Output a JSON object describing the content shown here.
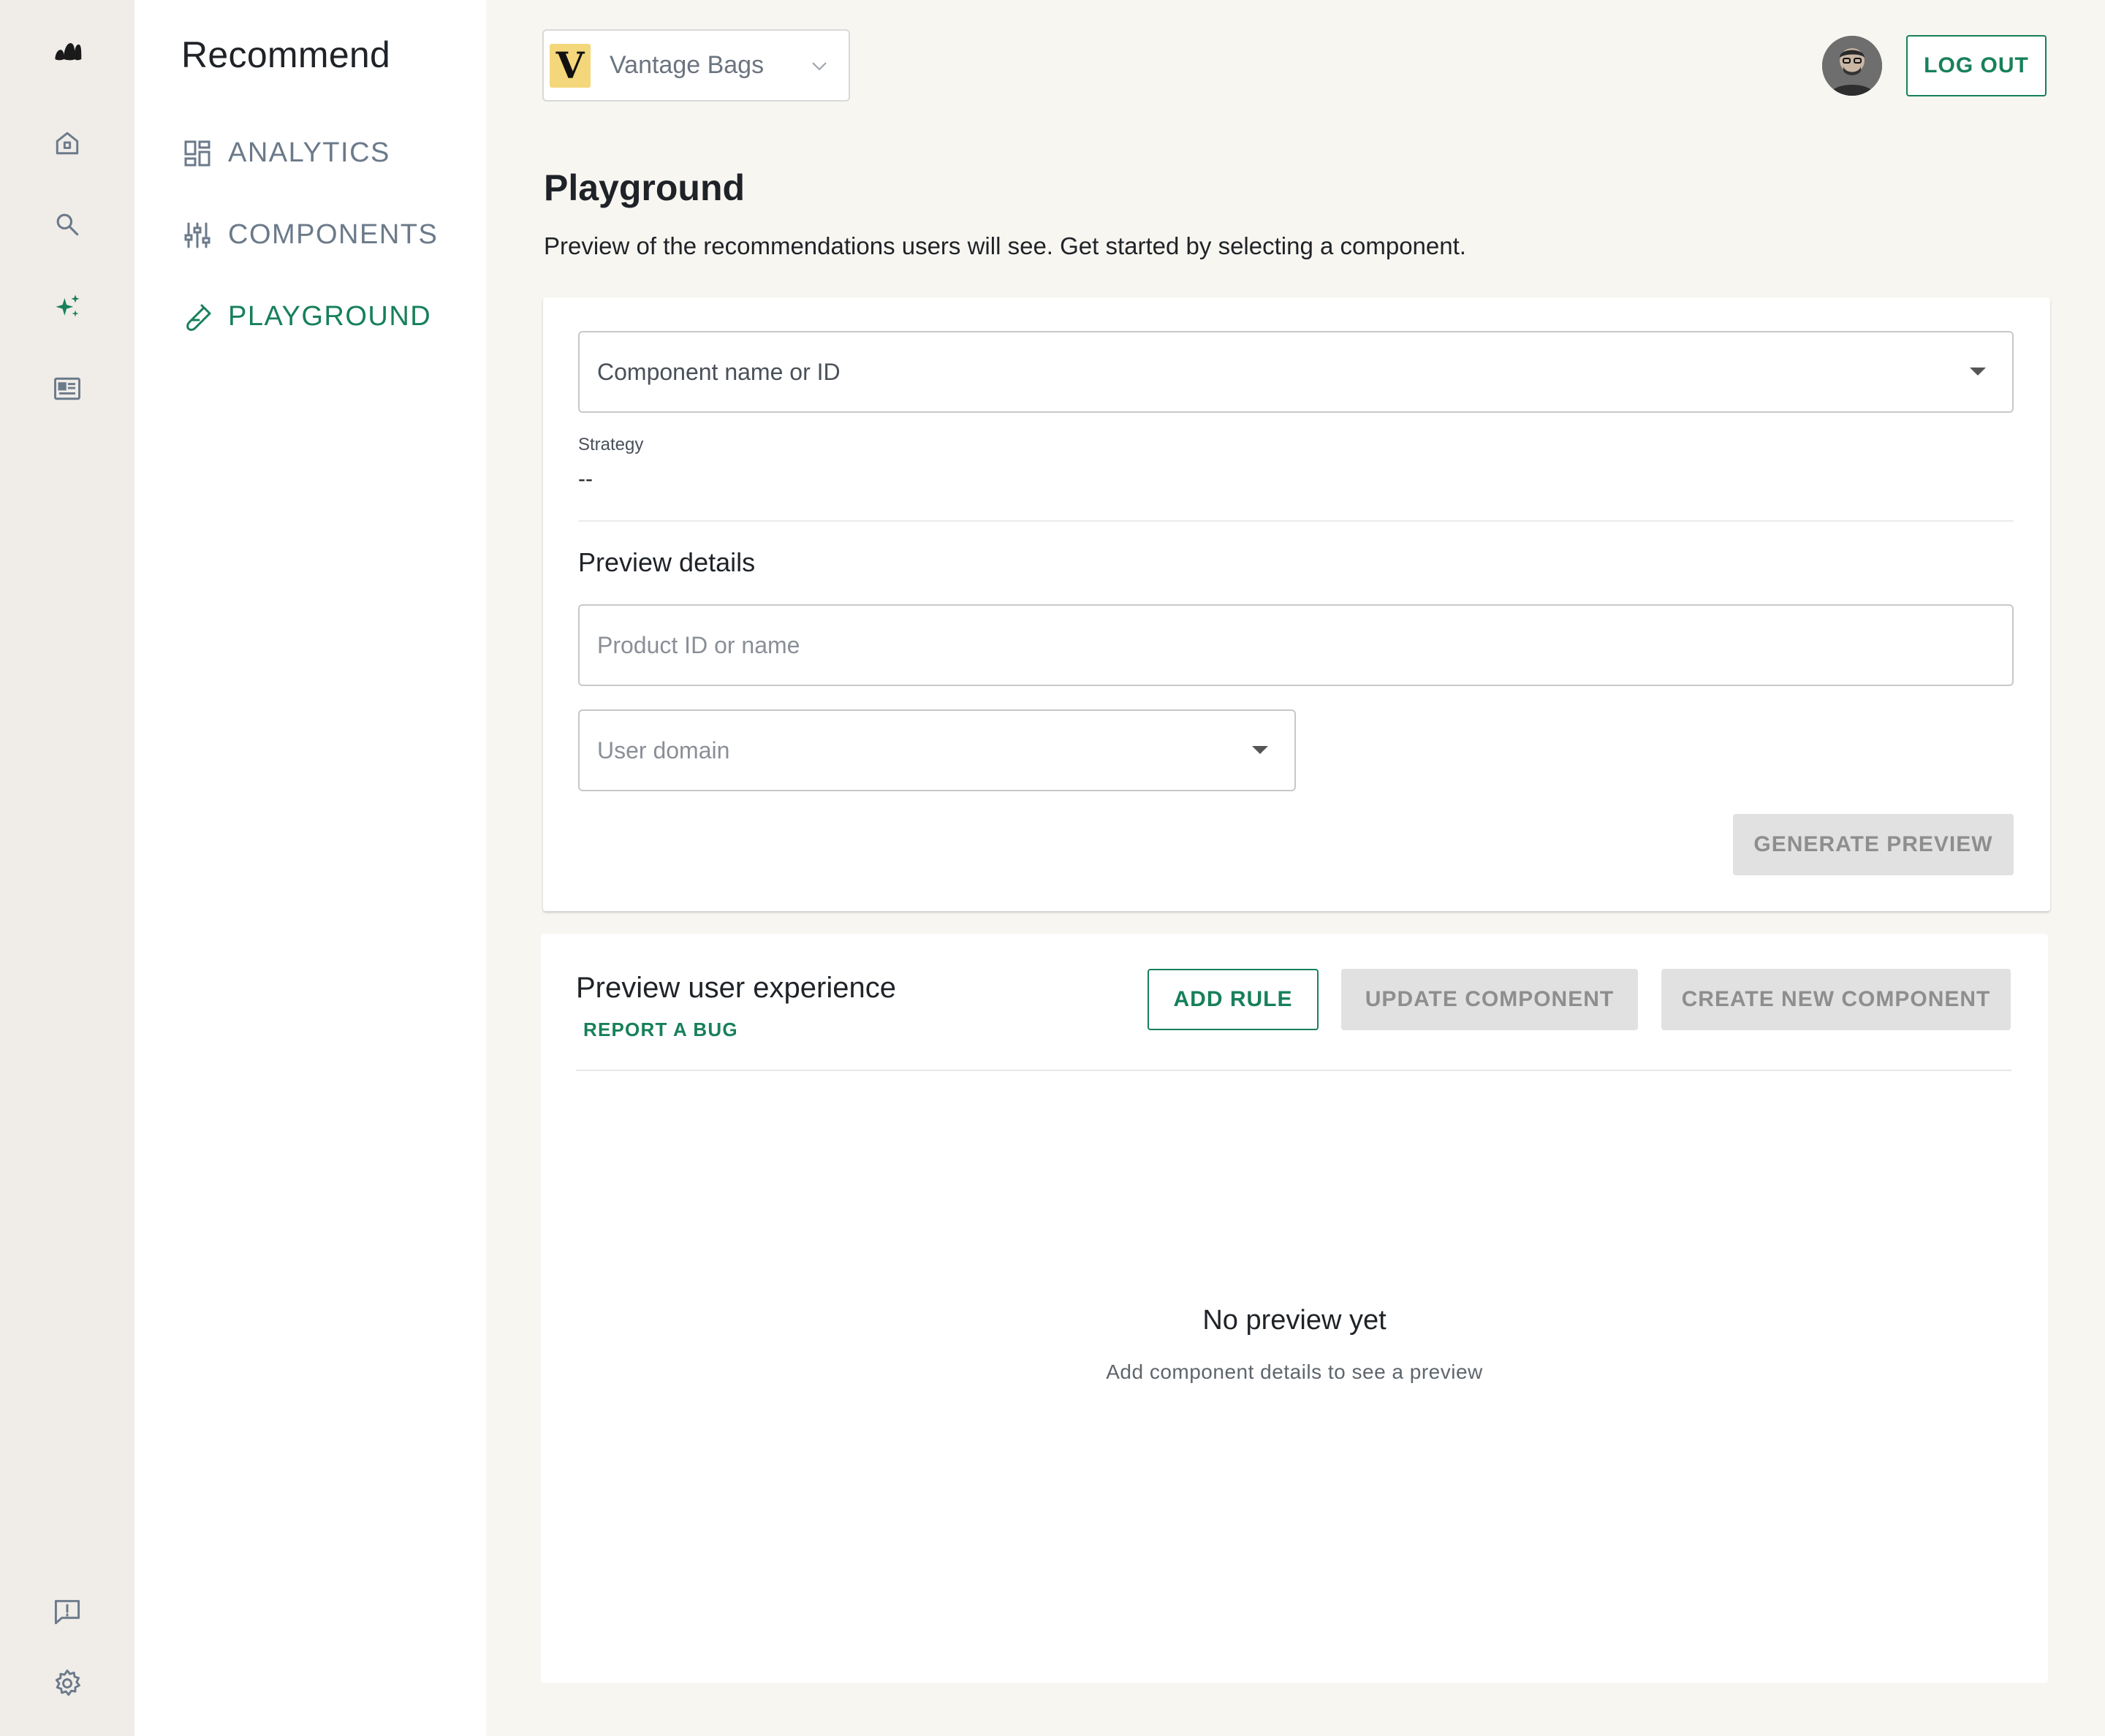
{
  "rail": {
    "items": [
      {
        "icon": "brand-logo-icon"
      },
      {
        "icon": "home-icon"
      },
      {
        "icon": "search-icon"
      },
      {
        "icon": "sparkles-icon",
        "active": true
      },
      {
        "icon": "newspaper-icon"
      },
      {
        "icon": "feedback-icon"
      },
      {
        "icon": "gear-icon"
      }
    ]
  },
  "subnav": {
    "title": "Recommend",
    "items": [
      {
        "label": "ANALYTICS",
        "icon": "dashboard-icon"
      },
      {
        "label": "COMPONENTS",
        "icon": "sliders-icon"
      },
      {
        "label": "PLAYGROUND",
        "icon": "test-tube-icon",
        "active": true
      }
    ]
  },
  "topbar": {
    "store_logo_letter": "V",
    "store_name": "Vantage Bags",
    "logout_label": "LOG OUT"
  },
  "page": {
    "title": "Playground",
    "subtitle": "Preview of the recommendations users will see. Get started by selecting a component."
  },
  "config": {
    "component_placeholder": "Component name or ID",
    "strategy_label": "Strategy",
    "strategy_value": "--",
    "preview_details_heading": "Preview details",
    "product_placeholder": "Product ID or name",
    "user_domain_placeholder": "User domain",
    "generate_label": "GENERATE PREVIEW"
  },
  "preview": {
    "title": "Preview user experience",
    "report_bug_label": "REPORT A BUG",
    "add_rule_label": "ADD RULE",
    "update_label": "UPDATE COMPONENT",
    "create_label": "CREATE NEW COMPONENT",
    "empty_title": "No preview yet",
    "empty_subtitle": "Add component details to see a preview"
  },
  "colors": {
    "accent": "#17805a",
    "rail_bg": "#f0ece8",
    "page_bg": "#f8f6f1",
    "disabled_bg": "#e1e1e1"
  }
}
